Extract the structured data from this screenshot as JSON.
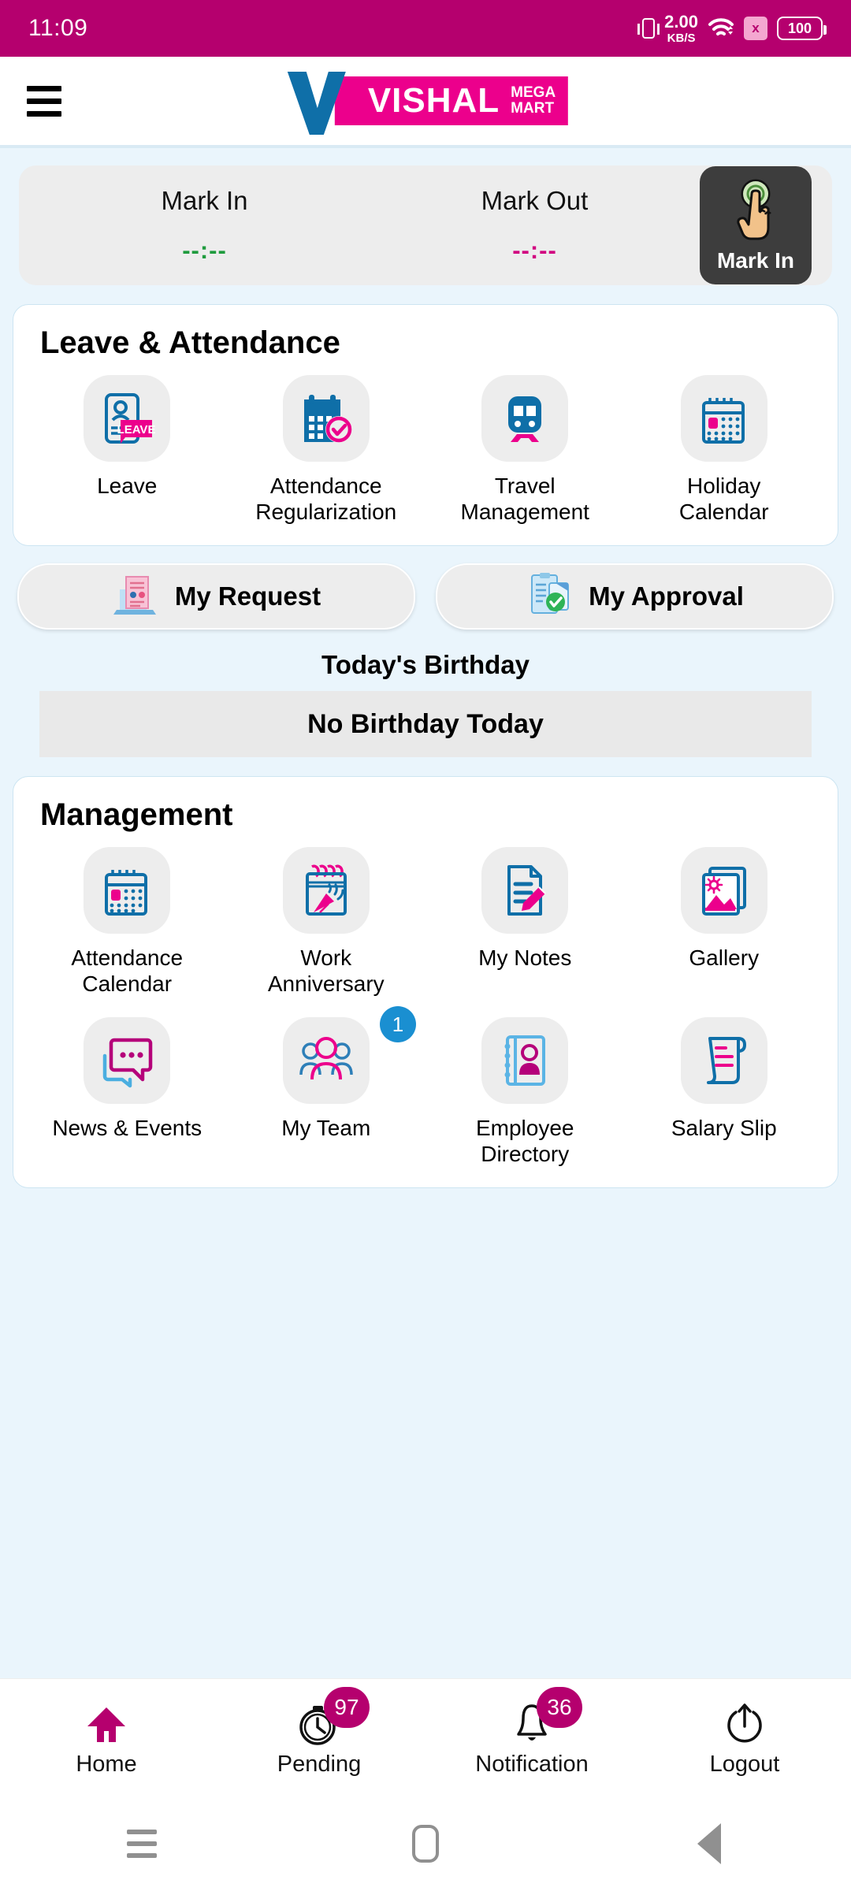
{
  "status_bar": {
    "time": "11:09",
    "data_speed_value": "2.00",
    "data_speed_unit": "KB/S",
    "sim_label": "x",
    "battery": "100"
  },
  "header": {
    "menu_icon": "hamburger-icon",
    "brand_primary": "VISHAL",
    "brand_secondary_line1": "MEGA",
    "brand_secondary_line2": "MART"
  },
  "attendance_panel": {
    "mark_in_label": "Mark In",
    "mark_in_time": "--:--",
    "mark_out_label": "Mark Out",
    "mark_out_time": "--:--",
    "button_label": "Mark In",
    "mark_in_color": "#1f9b3e",
    "mark_out_color": "#d1007f"
  },
  "leave_attendance": {
    "title": "Leave & Attendance",
    "tiles": [
      {
        "label": "Leave",
        "icon": "id-card-leave-icon"
      },
      {
        "label": "Attendance Regularization",
        "icon": "calendar-check-icon"
      },
      {
        "label": "Travel Management",
        "icon": "train-icon"
      },
      {
        "label": "Holiday Calendar",
        "icon": "calendar-icon"
      }
    ]
  },
  "quick_actions": [
    {
      "label": "My Request",
      "icon": "laptop-document-icon"
    },
    {
      "label": "My Approval",
      "icon": "clipboard-check-icon"
    }
  ],
  "birthday": {
    "title": "Today's Birthday",
    "empty_message": "No Birthday Today"
  },
  "management": {
    "title": "Management",
    "row1": [
      {
        "label": "Attendance Calendar",
        "icon": "calendar-icon"
      },
      {
        "label": "Work Anniversary",
        "icon": "party-popper-notepad-icon"
      },
      {
        "label": "My Notes",
        "icon": "note-pencil-icon"
      },
      {
        "label": "Gallery",
        "icon": "photo-gallery-icon"
      }
    ],
    "row2": [
      {
        "label": "News & Events",
        "icon": "chat-bubbles-icon",
        "badge": ""
      },
      {
        "label": "My Team",
        "icon": "people-group-icon",
        "badge": "1"
      },
      {
        "label": "Employee Directory",
        "icon": "contact-book-icon",
        "badge": ""
      },
      {
        "label": "Salary Slip",
        "icon": "receipt-icon",
        "badge": ""
      }
    ]
  },
  "bottom_nav": [
    {
      "label": "Home",
      "icon": "home-icon",
      "badge": "",
      "active": true
    },
    {
      "label": "Pending",
      "icon": "stopwatch-icon",
      "badge": "97",
      "active": false
    },
    {
      "label": "Notification",
      "icon": "bell-icon",
      "badge": "36",
      "active": false
    },
    {
      "label": "Logout",
      "icon": "power-icon",
      "badge": "",
      "active": false
    }
  ],
  "android_nav": {
    "recents_icon": "recents-icon",
    "home_icon": "android-home-icon",
    "back_icon": "android-back-icon"
  },
  "colors": {
    "status_bar": "#b5006e",
    "brand_pink": "#ec008c",
    "brand_blue": "#0f6fa8",
    "page_background": "#eaf5fc",
    "badge_blue": "#1a8fd1",
    "badge_pink": "#b5006e"
  }
}
